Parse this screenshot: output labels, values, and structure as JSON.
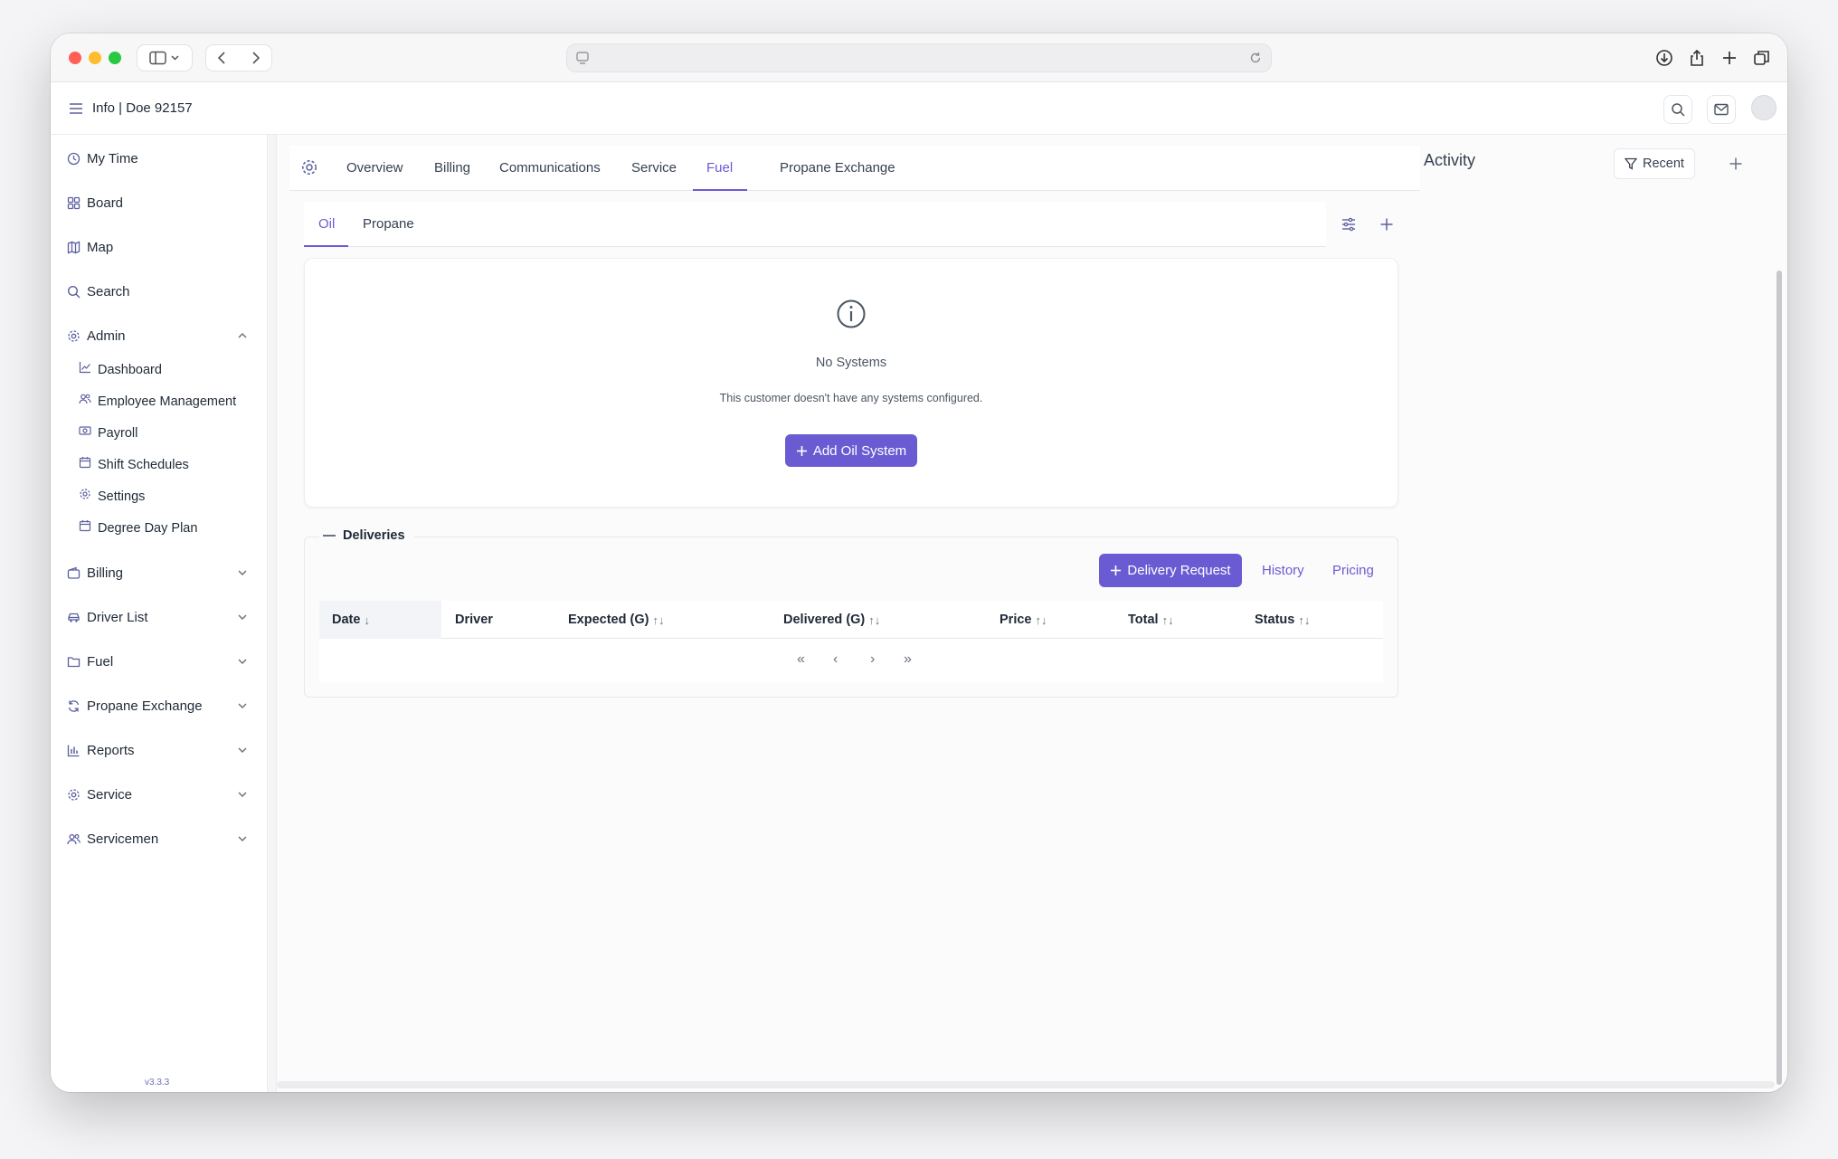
{
  "header": {
    "title": "Info | Doe 92157"
  },
  "sidebar": {
    "items": [
      {
        "label": "My Time",
        "icon": "clock-icon"
      },
      {
        "label": "Board",
        "icon": "grid-icon"
      },
      {
        "label": "Map",
        "icon": "map-icon"
      },
      {
        "label": "Search",
        "icon": "search-icon"
      },
      {
        "label": "Admin",
        "icon": "gear-icon"
      }
    ],
    "admin_children": [
      {
        "label": "Dashboard",
        "icon": "chart-icon"
      },
      {
        "label": "Employee Management",
        "icon": "users-icon"
      },
      {
        "label": "Payroll",
        "icon": "money-icon"
      },
      {
        "label": "Shift Schedules",
        "icon": "calendar-icon"
      },
      {
        "label": "Settings",
        "icon": "gear-icon"
      },
      {
        "label": "Degree Day Plan",
        "icon": "calendar-icon"
      }
    ],
    "groups": [
      {
        "label": "Billing",
        "icon": "wallet-icon"
      },
      {
        "label": "Driver List",
        "icon": "car-icon"
      },
      {
        "label": "Fuel",
        "icon": "folder-icon"
      },
      {
        "label": "Propane Exchange",
        "icon": "refresh-icon"
      },
      {
        "label": "Reports",
        "icon": "bar-chart-icon"
      },
      {
        "label": "Service",
        "icon": "gear-icon"
      },
      {
        "label": "Servicemen",
        "icon": "users-icon"
      }
    ],
    "version": "v3.3.3"
  },
  "tabs": [
    {
      "label": "Overview"
    },
    {
      "label": "Billing"
    },
    {
      "label": "Communications"
    },
    {
      "label": "Service"
    },
    {
      "label": "Fuel"
    },
    {
      "label": "Propane Exchange"
    }
  ],
  "active_tab": "Fuel",
  "subtabs": [
    {
      "label": "Oil"
    },
    {
      "label": "Propane"
    }
  ],
  "active_subtab": "Oil",
  "empty_state": {
    "title": "No Systems",
    "description": "This customer doesn't have any systems configured.",
    "button_label": "Add Oil System"
  },
  "deliveries": {
    "legend": "Deliveries",
    "request_button": "Delivery Request",
    "history_link": "History",
    "pricing_link": "Pricing",
    "columns": [
      {
        "label": "Date",
        "sort": "↓"
      },
      {
        "label": "Driver",
        "sort": ""
      },
      {
        "label": "Expected (G)",
        "sort": "↑↓"
      },
      {
        "label": "Delivered (G)",
        "sort": "↑↓"
      },
      {
        "label": "Price",
        "sort": "↑↓"
      },
      {
        "label": "Total",
        "sort": "↑↓"
      },
      {
        "label": "Status",
        "sort": "↑↓"
      }
    ],
    "pagination": [
      "«",
      "‹",
      "›",
      "»"
    ]
  },
  "activity": {
    "title": "Activity",
    "filter_label": "Recent"
  },
  "colors": {
    "accent": "#6b5bd2"
  }
}
